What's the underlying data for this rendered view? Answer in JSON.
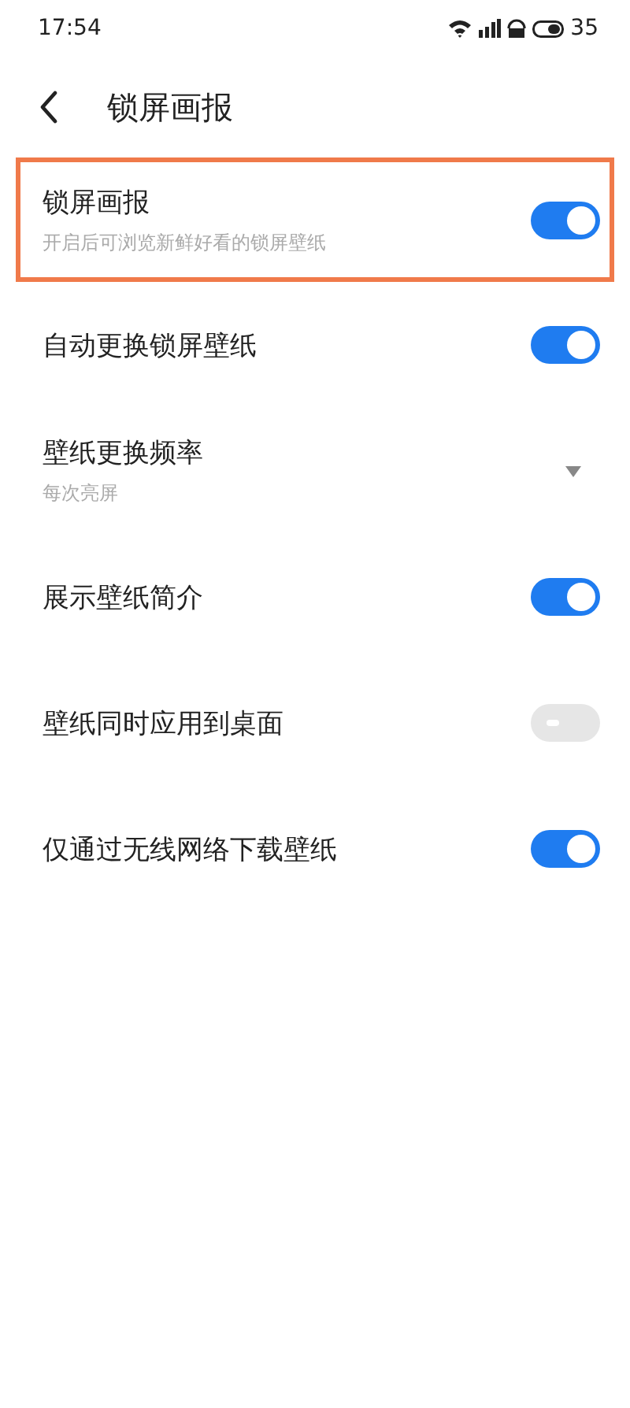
{
  "status_bar": {
    "time": "17:54",
    "battery": "35"
  },
  "header": {
    "title": "锁屏画报"
  },
  "settings": [
    {
      "kind": "toggle",
      "label": "锁屏画报",
      "subtitle": "开启后可浏览新鲜好看的锁屏壁纸",
      "on": true,
      "highlighted": true
    },
    {
      "kind": "toggle",
      "label": "自动更换锁屏壁纸",
      "on": true,
      "highlighted": false
    },
    {
      "kind": "dropdown",
      "label": "壁纸更换频率",
      "subtitle": "每次亮屏",
      "highlighted": false
    },
    {
      "kind": "toggle",
      "label": "展示壁纸简介",
      "on": true,
      "highlighted": false
    },
    {
      "kind": "toggle",
      "label": "壁纸同时应用到桌面",
      "on": false,
      "highlighted": false
    },
    {
      "kind": "toggle",
      "label": "仅通过无线网络下载壁纸",
      "on": true,
      "highlighted": false
    }
  ]
}
